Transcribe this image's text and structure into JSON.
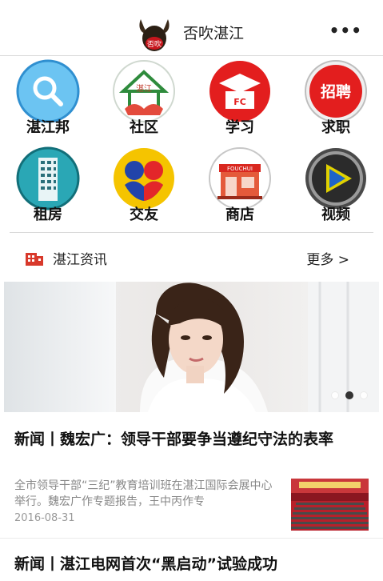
{
  "header": {
    "title": "否吹湛江",
    "logo_text": "否吹",
    "menu_icon": "more-dots-icon"
  },
  "grid": {
    "items": [
      {
        "label": "湛江邦",
        "icon": "search-icon",
        "color": "#2f9be0"
      },
      {
        "label": "社区",
        "icon": "community-house-icon",
        "icon_text": "湛江",
        "color": "#2e8b3c"
      },
      {
        "label": "学习",
        "icon": "graduation-cap-icon",
        "icon_text": "FC",
        "color": "#e31e1e"
      },
      {
        "label": "求职",
        "icon": "recruit-badge-icon",
        "icon_text": "招聘",
        "color": "#e31e1e"
      },
      {
        "label": "租房",
        "icon": "building-icon",
        "color": "#2aa7b5"
      },
      {
        "label": "交友",
        "icon": "friends-icon",
        "color": "#f5c400"
      },
      {
        "label": "商店",
        "icon": "shop-icon",
        "icon_text": "FOUCHUI",
        "color": "#d9271f"
      },
      {
        "label": "视频",
        "icon": "play-video-icon",
        "color": "#2a2a2a"
      }
    ]
  },
  "news_section": {
    "title": "湛江资讯",
    "more_label": "更多 >"
  },
  "banner": {
    "image": "woman-portrait-photo",
    "dots": 3,
    "active_dot": 2
  },
  "articles": [
    {
      "title": "新闻丨魏宏广：领导干部要争当遵纪守法的表率",
      "summary": "全市领导干部“三纪”教育培训班在湛江国际会展中心举行。魏宏广作专题报告，王中丙作专",
      "date": "2016-08-31",
      "thumbnail": "meeting-hall-photo"
    },
    {
      "title": "新闻丨湛江电网首次“黑启动”试验成功"
    }
  ]
}
